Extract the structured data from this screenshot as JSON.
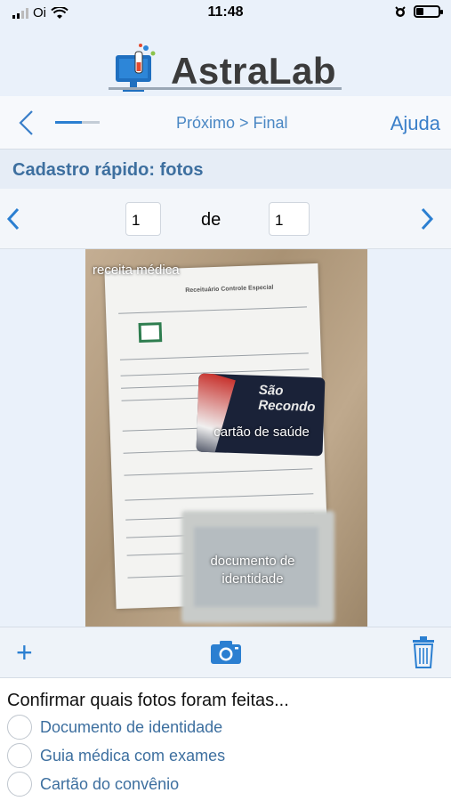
{
  "status_bar": {
    "carrier": "Oi",
    "time": "11:48",
    "battery_level": 0.35
  },
  "header": {
    "app_name": "AstraLab",
    "breadcrumb": "Próximo > Final",
    "help_label": "Ajuda",
    "progress": 0.6
  },
  "section": {
    "title": "Cadastro rápido: fotos"
  },
  "pager": {
    "current": "1",
    "of_label": "de",
    "total": "1"
  },
  "photo": {
    "labels": {
      "prescription": "receita médica",
      "health_card": "cartão de saúde",
      "id_doc_line1": "documento de",
      "id_doc_line2": "identidade"
    },
    "card_brand": "São Recondo"
  },
  "toolbar": {
    "icons": [
      "plus-icon",
      "camera-icon",
      "trash-icon"
    ]
  },
  "confirm": {
    "question": "Confirmar quais fotos foram feitas...",
    "options": [
      {
        "label": "Documento de identidade"
      },
      {
        "label": "Guia médica com exames"
      },
      {
        "label": "Cartão do convênio"
      }
    ]
  },
  "colors": {
    "accent": "#2b7fd1",
    "section_title": "#3d6f9f",
    "background": "#eaf1fa"
  }
}
